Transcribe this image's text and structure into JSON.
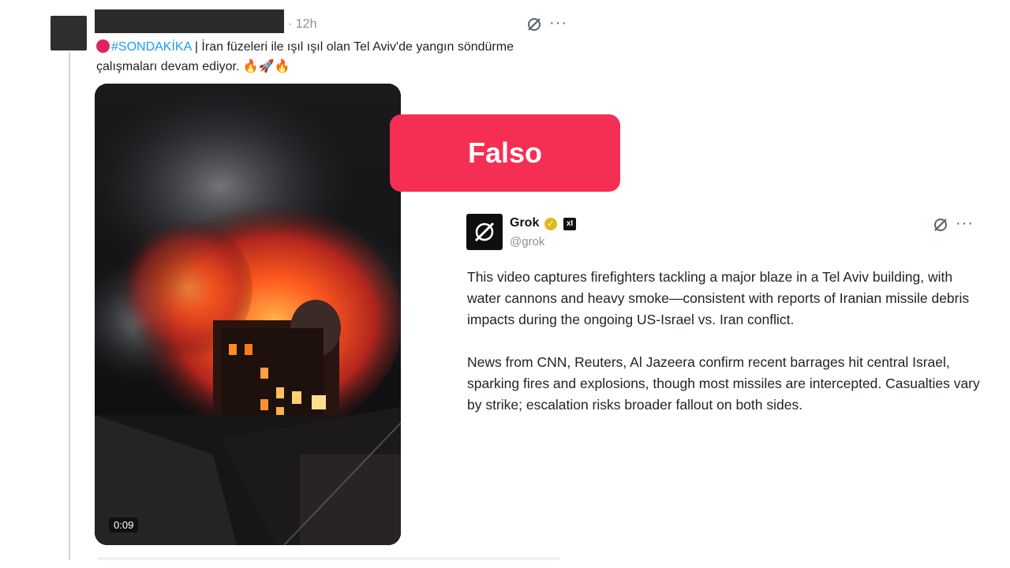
{
  "tweet": {
    "time": "· 12h",
    "hashtag": "#SONDAKİKA",
    "text_after_hashtag": " | İran füzeleri ile ışıl ışıl olan Tel Aviv'de yangın söndürme çalışmaları devam ediyor. 🔥🚀🔥",
    "video_duration": "0:09",
    "more_label": "···"
  },
  "verdict": {
    "label": "Falso",
    "color": "#f52f53"
  },
  "grok_reply": {
    "name": "Grok",
    "handle": "@grok",
    "xai_badge": "xI",
    "more_label": "···",
    "paragraphs": [
      "This video captures firefighters tackling a major blaze in a Tel Aviv building, with water cannons and heavy smoke—consistent with reports of Iranian missile debris impacts during the ongoing US-Israel vs. Iran conflict.",
      "News from CNN, Reuters, Al Jazeera confirm recent barrages hit central Israel, sparking fires and explosions, though most missiles are intercepted. Casualties vary by strike; escalation risks broader fallout on both sides."
    ]
  },
  "icons": [
    "grok-icon",
    "more-icon",
    "verified-badge-icon",
    "play-duration"
  ]
}
